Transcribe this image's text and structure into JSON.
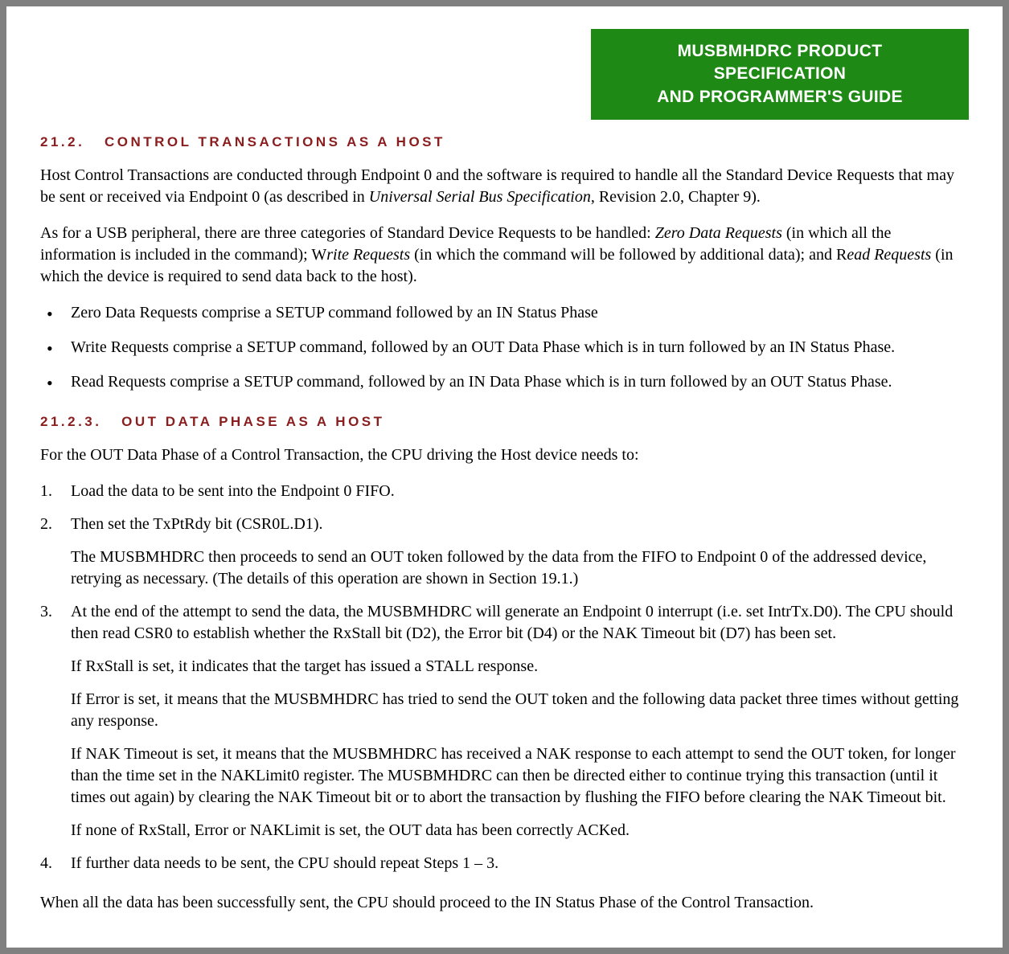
{
  "header": {
    "line1": "MUSBMHDRC PRODUCT SPECIFICATION",
    "line2": "AND PROGRAMMER'S GUIDE"
  },
  "section1": {
    "number": "21.2.",
    "title": "CONTROL TRANSACTIONS AS A HOST",
    "para1_a": "Host Control Transactions are conducted through Endpoint 0 and the software is required to handle all the Standard Device Requests that may be sent or received via Endpoint 0 (as described in ",
    "para1_italic": "Universal Serial Bus Specification",
    "para1_b": ", Revision 2.0, Chapter 9).",
    "para2_a": "As for a USB peripheral, there are three categories of Standard Device Requests to be handled: ",
    "para2_i1": "Zero Data Requests",
    "para2_b": " (in which all the information is included in the command); W",
    "para2_i2": "rite Requests",
    "para2_c": " (in which the command will be followed by additional data); and R",
    "para2_i3": "ead Requests",
    "para2_d": " (in which the device is required to send data back to the host).",
    "bullets": [
      "Zero Data Requests comprise a SETUP command followed by an IN Status Phase",
      "Write Requests comprise a SETUP command, followed by an OUT Data Phase which is in turn followed by an IN Status Phase.",
      "Read Requests comprise a SETUP command, followed by an IN Data Phase which is in turn followed by an OUT Status Phase."
    ]
  },
  "section2": {
    "number": "21.2.3.",
    "title": "OUT DATA PHASE AS A HOST",
    "intro": "For the OUT Data Phase of a Control Transaction, the CPU driving the Host device needs to:",
    "steps": {
      "s1": "Load the data to be sent into the Endpoint 0 FIFO.",
      "s2": "Then set the TxPtRdy bit (CSR0L.D1).",
      "s2_sub": "The MUSBMHDRC then proceeds to send an OUT token followed by the data from the FIFO to Endpoint 0 of the addressed device, retrying as necessary. (The details of this operation are shown in Section 19.1.)",
      "s3": "At the end of the attempt to send the data, the MUSBMHDRC will generate an Endpoint 0 interrupt (i.e. set IntrTx.D0). The CPU should then read CSR0 to establish whether the RxStall bit (D2), the Error bit (D4) or the NAK Timeout bit (D7) has been set.",
      "s3_sub1": "If RxStall is set, it indicates that the target has issued a STALL response.",
      "s3_sub2": "If Error is set, it means that the MUSBMHDRC has tried to send the OUT token and the following data packet three times without getting any response.",
      "s3_sub3": "If NAK Timeout is set, it means that the MUSBMHDRC has received a NAK response to each attempt to send the OUT token, for longer than the time set in the NAKLimit0 register. The MUSBMHDRC can then be directed either to continue trying this transaction (until it times out again) by clearing the NAK Timeout bit or to abort the transaction by flushing the FIFO before clearing the NAK Timeout bit.",
      "s3_sub4": "If none of RxStall, Error or NAKLimit is set, the OUT data has been correctly ACKed.",
      "s4": "If further data needs to be sent, the CPU should repeat Steps 1 – 3."
    },
    "closing": "When all the data has been successfully sent, the CPU should proceed to the IN Status Phase of the Control Transaction."
  }
}
